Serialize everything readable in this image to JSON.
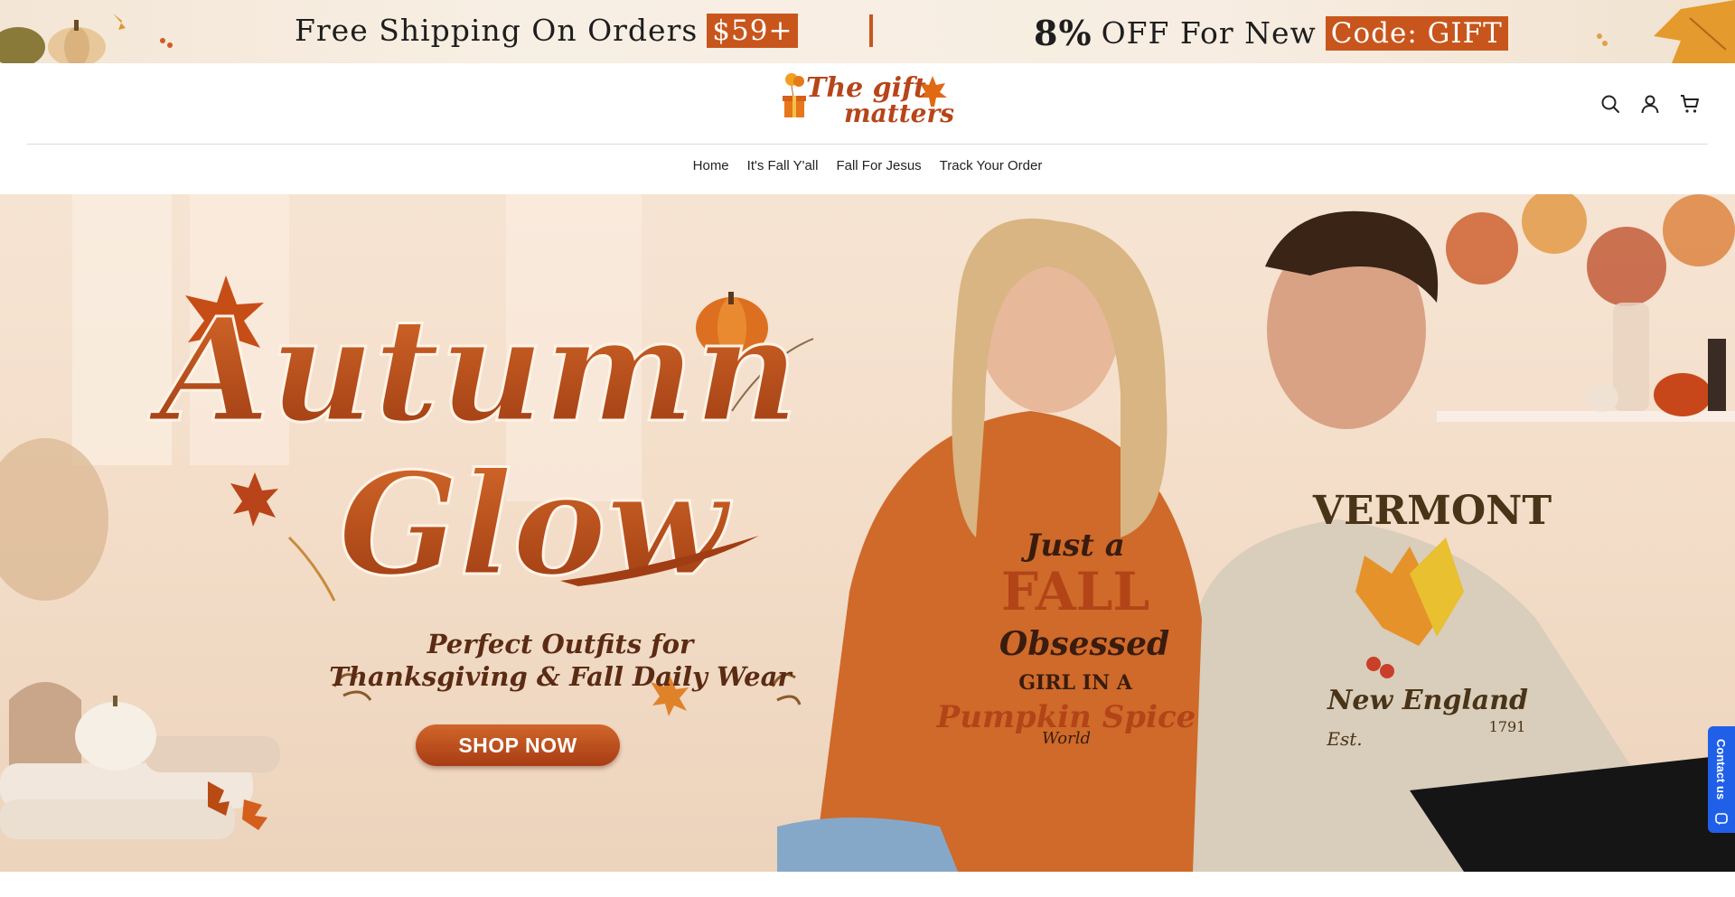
{
  "announcement": {
    "shipping_text": "Free Shipping On Orders",
    "shipping_highlight": "$59+",
    "discount_percent": "8%",
    "discount_text": "OFF For New",
    "discount_code": "Code: GIFT"
  },
  "header": {
    "logo_line1": "The gift",
    "logo_line2": "matters",
    "icons": [
      "search-icon",
      "account-icon",
      "cart-icon"
    ]
  },
  "nav": {
    "items": [
      {
        "label": "Home"
      },
      {
        "label": "It's Fall Y'all"
      },
      {
        "label": "Fall For Jesus"
      },
      {
        "label": "Track Your Order"
      }
    ]
  },
  "hero": {
    "title_line1": "Autumn",
    "title_line2": "Glow",
    "subtitle_line1": "Perfect Outfits for",
    "subtitle_line2": "Thanksgiving & Fall Daily Wear",
    "cta_label": "SHOP NOW",
    "shirt_left_lines": [
      "Just a",
      "FALL",
      "Obsessed",
      "GIRL IN A",
      "Pumpkin Spice",
      "World"
    ],
    "shirt_right_lines": [
      "VERMONT",
      "New England",
      "Est.",
      "1791"
    ]
  },
  "contact": {
    "label": "Contact us"
  },
  "colors": {
    "accent": "#c8561c",
    "contact_blue": "#2060e8"
  }
}
